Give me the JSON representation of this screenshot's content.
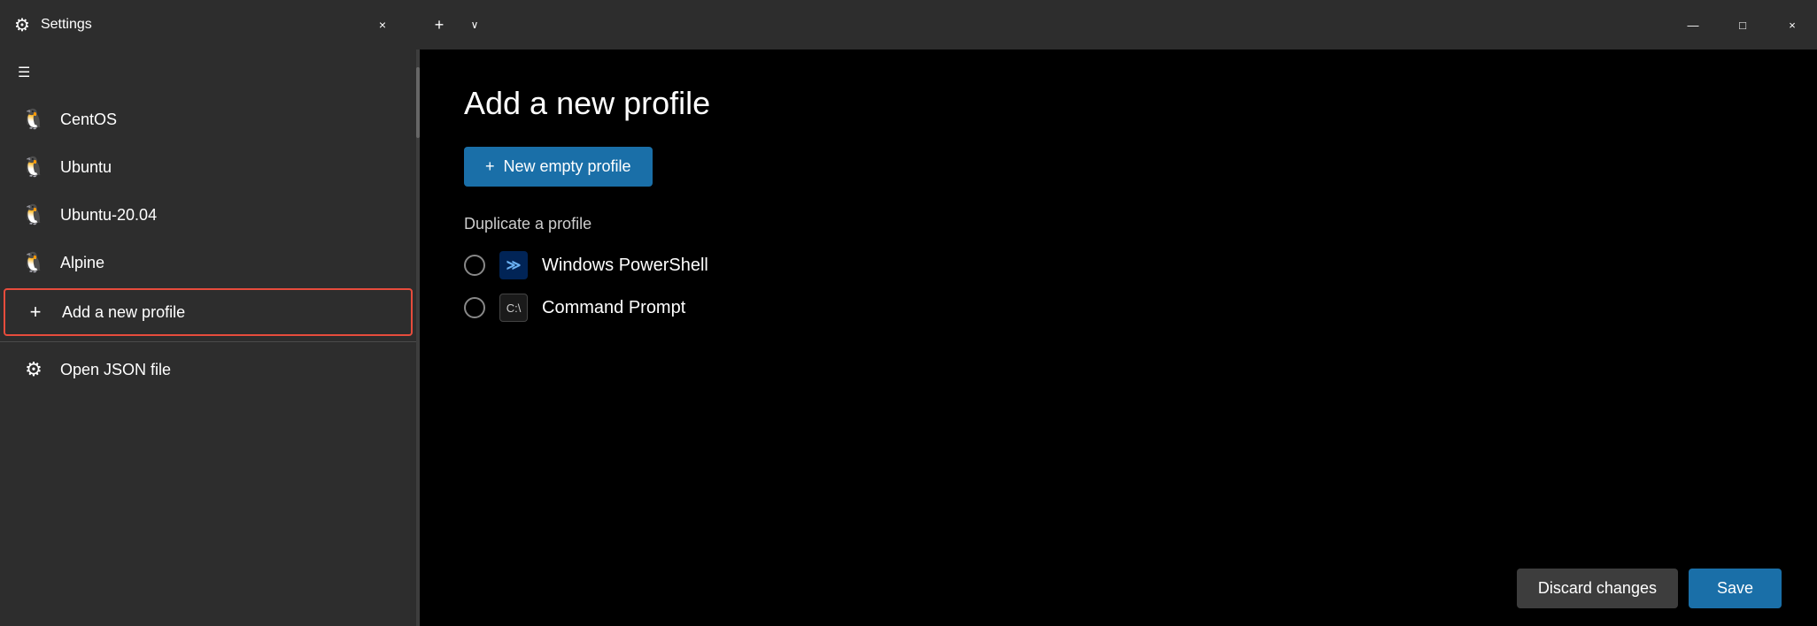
{
  "titlebar": {
    "settings_label": "Settings",
    "close_symbol": "×",
    "add_tab_symbol": "+",
    "dropdown_symbol": "∨",
    "minimize_symbol": "—",
    "maximize_symbol": "□",
    "window_close_symbol": "×"
  },
  "sidebar": {
    "hamburger_symbol": "☰",
    "items": [
      {
        "label": "CentOS",
        "icon": "🐧"
      },
      {
        "label": "Ubuntu",
        "icon": "🐧"
      },
      {
        "label": "Ubuntu-20.04",
        "icon": "🐧"
      },
      {
        "label": "Alpine",
        "icon": "🐧"
      }
    ],
    "add_profile_label": "Add a new profile",
    "add_profile_icon": "+",
    "open_json_label": "Open JSON file",
    "gear_symbol": "⚙"
  },
  "content": {
    "page_title": "Add a new profile",
    "new_profile_button": "New empty profile",
    "new_profile_plus": "+",
    "duplicate_label": "Duplicate a profile",
    "profiles": [
      {
        "name": "Windows PowerShell",
        "type": "powershell"
      },
      {
        "name": "Command Prompt",
        "type": "cmd"
      }
    ],
    "discard_button": "Discard changes",
    "save_button": "Save"
  }
}
